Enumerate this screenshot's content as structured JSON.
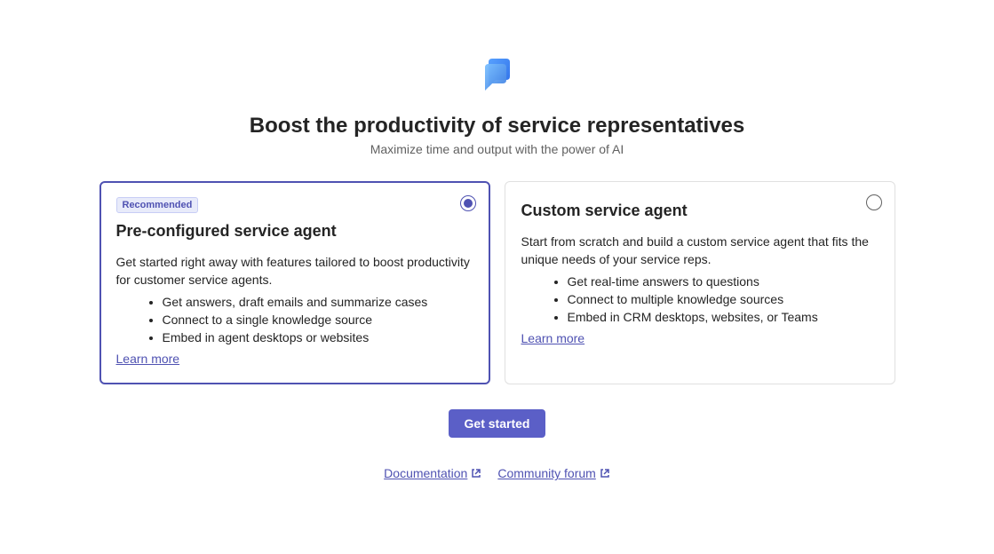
{
  "header": {
    "title": "Boost the productivity of service representatives",
    "subtitle": "Maximize time and output with the power of AI"
  },
  "options": {
    "preconfigured": {
      "badge": "Recommended",
      "title": "Pre-configured service agent",
      "description": "Get started right away with features tailored to boost productivity for customer service agents.",
      "bullets": [
        "Get answers, draft emails and summarize cases",
        "Connect to a single knowledge source",
        "Embed in agent desktops or websites"
      ],
      "learn_more": "Learn more",
      "selected": true
    },
    "custom": {
      "title": "Custom service agent",
      "description": "Start from scratch and build a custom service agent that fits the unique needs of your service reps.",
      "bullets": [
        "Get real-time answers to questions",
        "Connect to multiple knowledge sources",
        "Embed in CRM desktops, websites, or Teams"
      ],
      "learn_more": "Learn more",
      "selected": false
    }
  },
  "actions": {
    "primary": "Get started"
  },
  "footer": {
    "documentation": "Documentation",
    "community": "Community forum"
  }
}
